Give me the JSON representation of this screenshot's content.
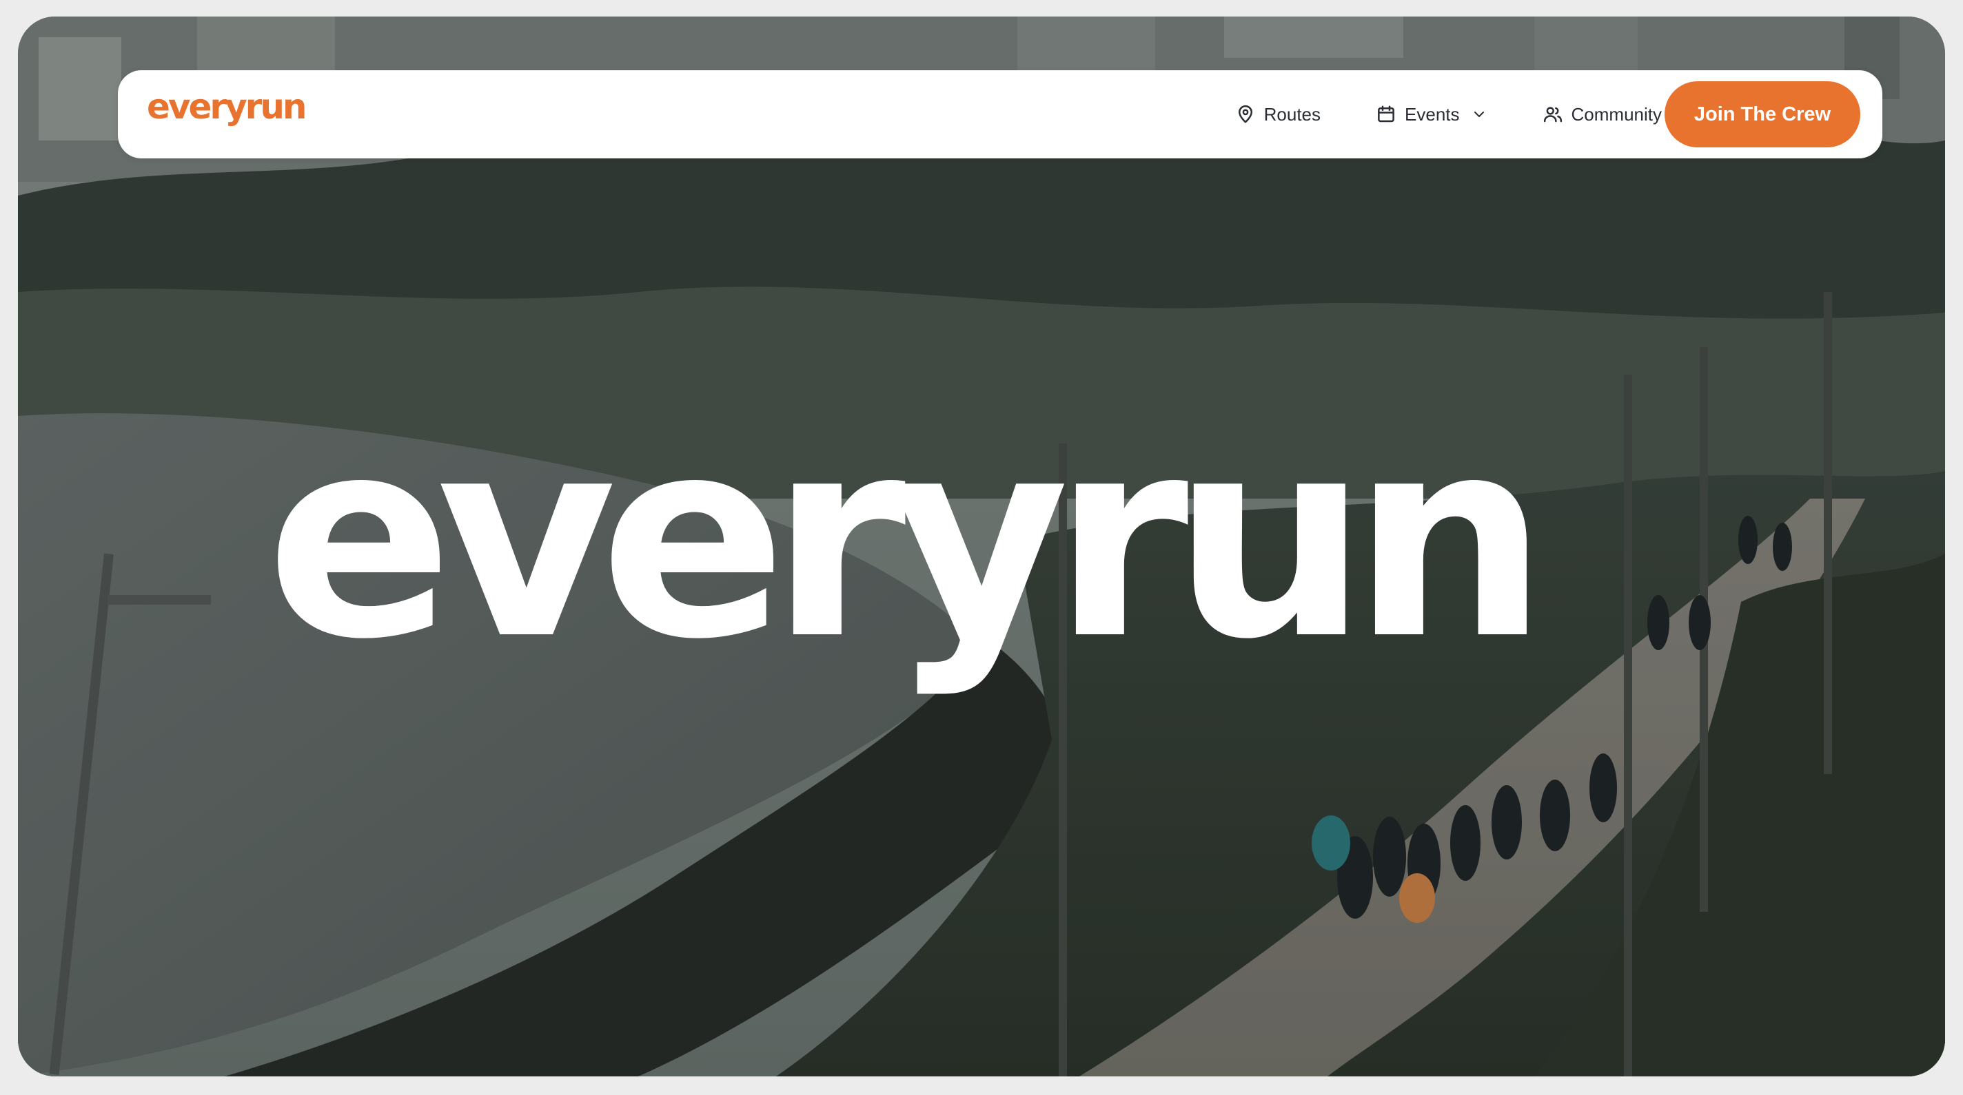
{
  "brand": {
    "logo_text": "everyrun",
    "hero_wordmark": "everyrun",
    "accent_color": "#e8732e"
  },
  "nav": {
    "items": [
      {
        "label": "Routes",
        "icon": "map-pin-icon"
      },
      {
        "label": "Events",
        "icon": "calendar-icon",
        "has_dropdown": true
      },
      {
        "label": "Community",
        "icon": "users-icon"
      }
    ],
    "cta_label": "Join The Crew"
  },
  "hero": {
    "background": "aerial coastal running path photo"
  }
}
